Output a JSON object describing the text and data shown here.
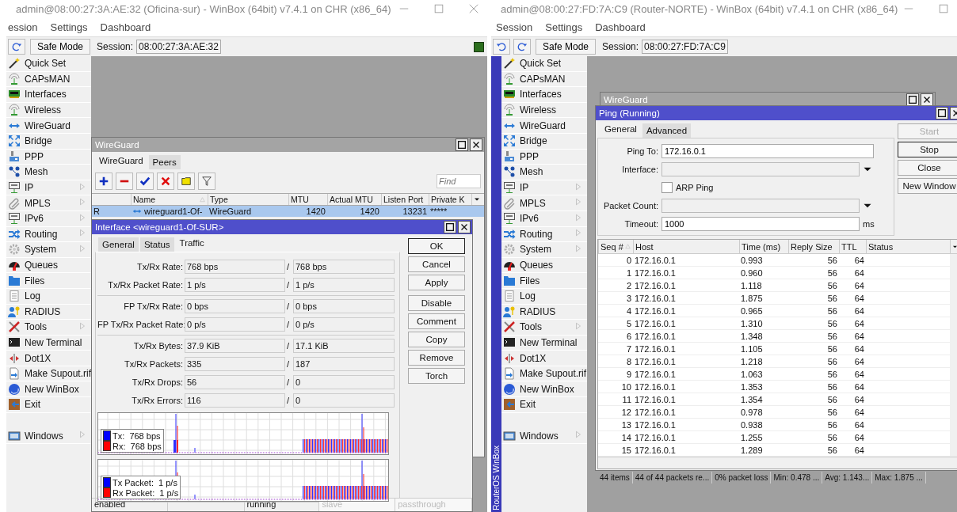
{
  "apps": [
    {
      "title": "admin@08:00:27:3A:AE:32 (Oficina-sur) - WinBox (64bit) v7.4.1 on CHR (x86_64)",
      "menu": [
        "ession",
        "Settings",
        "Dashboard"
      ],
      "safe_mode": "Safe Mode",
      "session_label": "Session:",
      "session": "08:00:27:3A:AE:32",
      "indicator": true,
      "sidebar": {
        "items": [
          {
            "label": "Quick Set",
            "submenu": false
          },
          {
            "label": "CAPsMAN",
            "submenu": false
          },
          {
            "label": "Interfaces",
            "submenu": false
          },
          {
            "label": "Wireless",
            "submenu": false
          },
          {
            "label": "WireGuard",
            "submenu": false
          },
          {
            "label": "Bridge",
            "submenu": false
          },
          {
            "label": "PPP",
            "submenu": false
          },
          {
            "label": "Mesh",
            "submenu": false
          },
          {
            "label": "IP",
            "submenu": true
          },
          {
            "label": "MPLS",
            "submenu": true
          },
          {
            "label": "IPv6",
            "submenu": true
          },
          {
            "label": "Routing",
            "submenu": true
          },
          {
            "label": "System",
            "submenu": true
          },
          {
            "label": "Queues",
            "submenu": false
          },
          {
            "label": "Files",
            "submenu": false
          },
          {
            "label": "Log",
            "submenu": false
          },
          {
            "label": "RADIUS",
            "submenu": false
          },
          {
            "label": "Tools",
            "submenu": true
          },
          {
            "label": "New Terminal",
            "submenu": false
          },
          {
            "label": "Dot1X",
            "submenu": false
          },
          {
            "label": "Make Supout.rif",
            "submenu": false
          },
          {
            "label": "New WinBox",
            "submenu": false
          },
          {
            "label": "Exit",
            "submenu": false
          }
        ],
        "footer_items": [
          {
            "label": "Windows",
            "submenu": true
          }
        ]
      },
      "windows": [
        {
          "kind": "wireguard",
          "title": "WireGuard",
          "active": false,
          "tabs": [
            {
              "label": "WireGuard",
              "selected": true
            },
            {
              "label": "Peers",
              "selected": false
            }
          ],
          "find_placeholder": "Find",
          "columns": [
            {
              "label": "Name",
              "sorted": true
            },
            {
              "label": "Type",
              "sorted": false
            },
            {
              "label": "MTU",
              "sorted": false
            },
            {
              "label": "Actual MTU",
              "sorted": false
            },
            {
              "label": "Listen Port",
              "sorted": false
            },
            {
              "label": "Private K",
              "sorted": false
            }
          ],
          "rows": [
            {
              "flag": "R",
              "cells": [
                "wireguard1-Of-",
                "WireGuard",
                "1420",
                "1420",
                "13231",
                "*****"
              ],
              "selected": true
            }
          ]
        },
        {
          "kind": "interface",
          "title": "Interface <wireguard1-Of-SUR>",
          "active": true,
          "tabs": [
            {
              "label": "General",
              "selected": false
            },
            {
              "label": "Status",
              "selected": false
            },
            {
              "label": "Traffic",
              "selected": true
            }
          ],
          "field_groups": [
            [
              {
                "label": "Tx/Rx Rate:",
                "tx": "768 bps",
                "sep": "/",
                "rx": "768 bps"
              },
              {
                "label": "Tx/Rx Packet Rate:",
                "tx": "1 p/s",
                "sep": "/",
                "rx": "1 p/s"
              }
            ],
            [
              {
                "label": "FP Tx/Rx Rate:",
                "tx": "0 bps",
                "sep": "/",
                "rx": "0 bps"
              },
              {
                "label": "FP Tx/Rx Packet Rate:",
                "tx": "0 p/s",
                "sep": "/",
                "rx": "0 p/s"
              }
            ],
            [
              {
                "label": "Tx/Rx Bytes:",
                "tx": "37.9 KiB",
                "sep": "/",
                "rx": "17.1 KiB"
              },
              {
                "label": "Tx/Rx Packets:",
                "tx": "335",
                "sep": "/",
                "rx": "187"
              },
              {
                "label": "Tx/Rx Drops:",
                "tx": "56",
                "sep": "/",
                "rx": "0"
              },
              {
                "label": "Tx/Rx Errors:",
                "tx": "116",
                "sep": "/",
                "rx": "0"
              }
            ]
          ],
          "graphs": [
            {
              "legend": [
                {
                  "text": "Tx:  768 bps",
                  "color": "#0000ff"
                },
                {
                  "text": "Rx:  768 bps",
                  "color": "#ff0000"
                }
              ]
            },
            {
              "legend": [
                {
                  "text": "Tx Packet:  1 p/s",
                  "color": "#0000ff"
                },
                {
                  "text": "Rx Packet:  1 p/s",
                  "color": "#ff0000"
                }
              ]
            }
          ],
          "button_groups": [
            [
              {
                "label": "OK",
                "default": true
              },
              {
                "label": "Cancel",
                "default": false
              },
              {
                "label": "Apply",
                "default": false
              }
            ],
            [
              {
                "label": "Disable",
                "default": false
              },
              {
                "label": "Comment",
                "default": false
              },
              {
                "label": "Copy",
                "default": false
              },
              {
                "label": "Remove",
                "default": false
              },
              {
                "label": "Torch",
                "default": false
              }
            ]
          ],
          "status_bar": [
            {
              "text": "enabled",
              "disabled": false
            },
            {
              "disabled": false
            },
            {
              "text": "running",
              "disabled": false
            },
            {
              "text": "slave",
              "disabled": true
            },
            {
              "text": "passthrough",
              "disabled": true
            }
          ]
        }
      ]
    },
    {
      "title": "admin@08:00:27:FD:7A:C9 (Router-NORTE) - WinBox (64bit) v7.4.1 on CHR (x86_64)",
      "menu": [
        "Session",
        "Settings",
        "Dashboard"
      ],
      "safe_mode": "Safe Mode",
      "session_label": "Session:",
      "session": "08:00:27:FD:7A:C9",
      "brand": "RouterOS WinBox",
      "sidebar": {
        "items": [
          {
            "label": "Quick Set",
            "submenu": false
          },
          {
            "label": "CAPsMAN",
            "submenu": false
          },
          {
            "label": "Interfaces",
            "submenu": false
          },
          {
            "label": "Wireless",
            "submenu": false
          },
          {
            "label": "WireGuard",
            "submenu": false
          },
          {
            "label": "Bridge",
            "submenu": false
          },
          {
            "label": "PPP",
            "submenu": false
          },
          {
            "label": "Mesh",
            "submenu": false
          },
          {
            "label": "IP",
            "submenu": true
          },
          {
            "label": "MPLS",
            "submenu": true
          },
          {
            "label": "IPv6",
            "submenu": true
          },
          {
            "label": "Routing",
            "submenu": true
          },
          {
            "label": "System",
            "submenu": true
          },
          {
            "label": "Queues",
            "submenu": false
          },
          {
            "label": "Files",
            "submenu": false
          },
          {
            "label": "Log",
            "submenu": false
          },
          {
            "label": "RADIUS",
            "submenu": false
          },
          {
            "label": "Tools",
            "submenu": true
          },
          {
            "label": "New Terminal",
            "submenu": false
          },
          {
            "label": "Dot1X",
            "submenu": false
          },
          {
            "label": "Make Supout.rif",
            "submenu": false
          },
          {
            "label": "New WinBox",
            "submenu": false
          },
          {
            "label": "Exit",
            "submenu": false
          }
        ],
        "footer_items": [
          {
            "label": "Windows",
            "submenu": true
          }
        ]
      },
      "windows": [
        {
          "kind": "wireguard",
          "title": "WireGuard",
          "active": false
        },
        {
          "kind": "ping",
          "title": "Ping (Running)",
          "active": true,
          "tabs": [
            {
              "label": "General",
              "selected": true
            },
            {
              "label": "Advanced",
              "selected": false
            }
          ],
          "fields": [
            {
              "kind": "text",
              "label": "Ping To:",
              "value": "172.16.0.1"
            },
            {
              "kind": "dropdown",
              "label": "Interface:"
            },
            {
              "kind": "checkbox",
              "label": "ARP Ping",
              "checked": false
            },
            {
              "kind": "dropdown",
              "label": "Packet Count:"
            },
            {
              "kind": "text",
              "label": "Timeout:",
              "value": "1000",
              "unit": "ms"
            }
          ],
          "buttons": [
            {
              "label": "Start",
              "disabled": true,
              "default": false
            },
            {
              "label": "Stop",
              "disabled": false,
              "default": true
            },
            {
              "label": "Close",
              "disabled": false,
              "default": false
            },
            {
              "label": "New Window",
              "disabled": false,
              "default": false
            }
          ],
          "columns": [
            {
              "label": "Seq #",
              "sorted": true
            },
            {
              "label": "Host",
              "sorted": false
            },
            {
              "label": "Time (ms)",
              "sorted": false
            },
            {
              "label": "Reply Size",
              "sorted": false
            },
            {
              "label": "TTL",
              "sorted": false
            },
            {
              "label": "Status",
              "sorted": false
            }
          ],
          "rows": [
            [
              "0",
              "172.16.0.1",
              "0.993",
              "56",
              "64"
            ],
            [
              "1",
              "172.16.0.1",
              "0.960",
              "56",
              "64"
            ],
            [
              "2",
              "172.16.0.1",
              "1.118",
              "56",
              "64"
            ],
            [
              "3",
              "172.16.0.1",
              "1.875",
              "56",
              "64"
            ],
            [
              "4",
              "172.16.0.1",
              "0.965",
              "56",
              "64"
            ],
            [
              "5",
              "172.16.0.1",
              "1.310",
              "56",
              "64"
            ],
            [
              "6",
              "172.16.0.1",
              "1.348",
              "56",
              "64"
            ],
            [
              "7",
              "172.16.0.1",
              "1.105",
              "56",
              "64"
            ],
            [
              "8",
              "172.16.0.1",
              "1.218",
              "56",
              "64"
            ],
            [
              "9",
              "172.16.0.1",
              "1.063",
              "56",
              "64"
            ],
            [
              "10",
              "172.16.0.1",
              "1.353",
              "56",
              "64"
            ],
            [
              "11",
              "172.16.0.1",
              "1.354",
              "56",
              "64"
            ],
            [
              "12",
              "172.16.0.1",
              "0.978",
              "56",
              "64"
            ],
            [
              "13",
              "172.16.0.1",
              "0.938",
              "56",
              "64"
            ],
            [
              "14",
              "172.16.0.1",
              "1.255",
              "56",
              "64"
            ],
            [
              "15",
              "172.16.0.1",
              "1.289",
              "56",
              "64"
            ]
          ],
          "status_bar": [
            "44 items",
            "44 of 44 packets re...",
            "0% packet loss",
            "Min: 0.478 ...",
            "Avg: 1.143...",
            "Max: 1.875 ..."
          ]
        }
      ]
    }
  ]
}
